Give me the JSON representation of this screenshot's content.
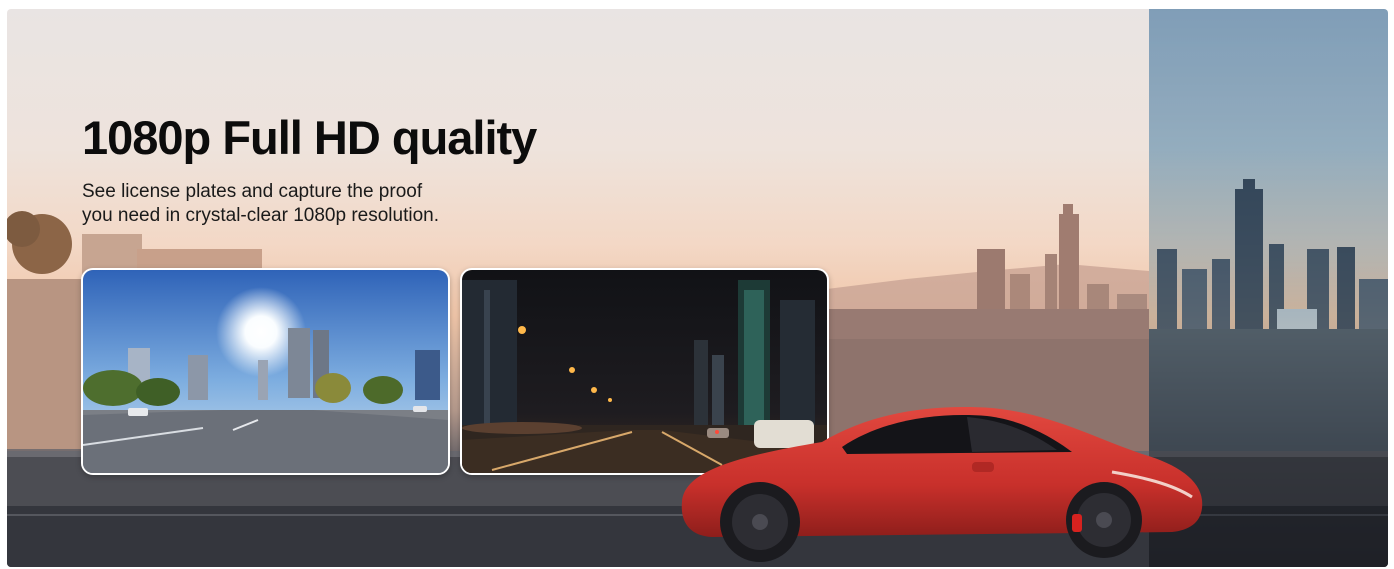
{
  "hero": {
    "headline": "1080p Full HD quality",
    "subtitle_line1": "See license plates and capture the proof",
    "subtitle_line2": "you need in crystal-clear 1080p resolution."
  },
  "images": {
    "day_frame": "daytime-dashcam-view",
    "night_frame": "nighttime-dashcam-view",
    "car": "red-sports-car",
    "background": "city-skyline-sunset"
  },
  "colors": {
    "headline": "#0c0c0c",
    "car": "#d2362f",
    "sky_right": "#2d6fa6",
    "frame_border": "#ffffff"
  }
}
